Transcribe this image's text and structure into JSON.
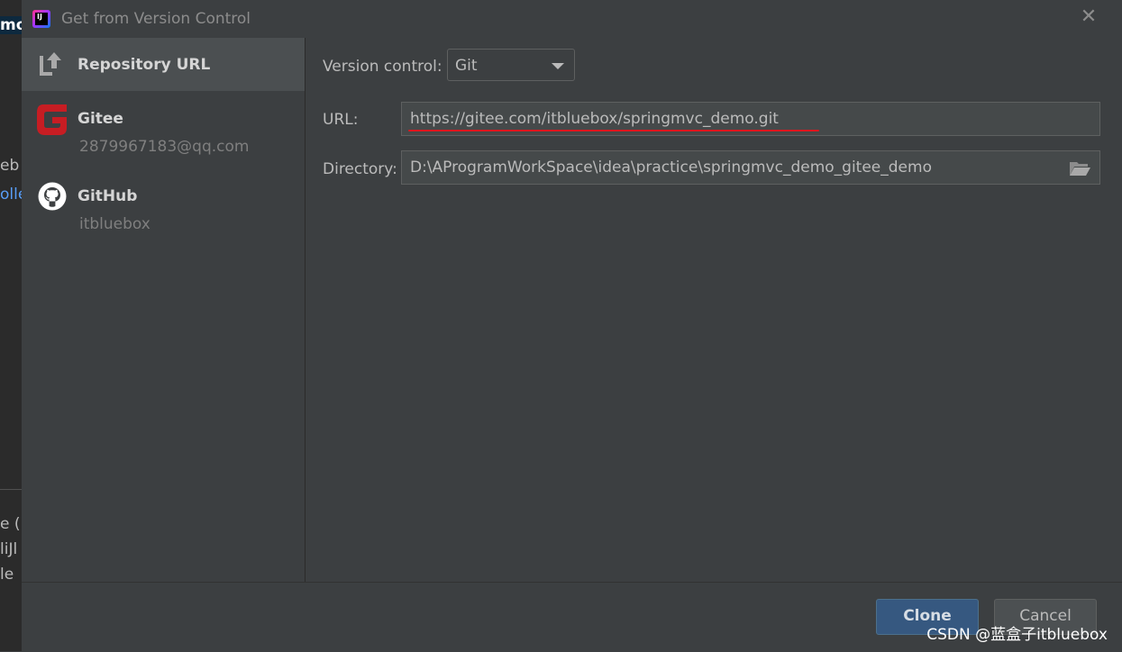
{
  "dialog": {
    "title": "Get from Version Control",
    "close_glyph": "✕"
  },
  "background_ide": {
    "fragments": [
      "mo",
      "eb",
      "olle",
      "e (",
      "liJl",
      "le"
    ]
  },
  "sidebar": {
    "items": [
      {
        "label": "Repository URL",
        "sub": "",
        "icon": "repository-url-icon",
        "selected": true
      },
      {
        "label": "Gitee",
        "sub": "2879967183@qq.com",
        "icon": "gitee-logo-icon",
        "selected": false
      },
      {
        "label": "GitHub",
        "sub": "itbluebox",
        "icon": "github-logo-icon",
        "selected": false
      }
    ]
  },
  "form": {
    "version_control_label": "Version control:",
    "version_control_value": "Git",
    "url_label": "URL:",
    "url_value": "https://gitee.com/itbluebox/springmvc_demo.git",
    "directory_label": "Directory:",
    "directory_value": "D:\\AProgramWorkSpace\\idea\\practice\\springmvc_demo_gitee_demo"
  },
  "buttons": {
    "clone": "Clone",
    "cancel": "Cancel"
  },
  "watermark": "CSDN @蓝盒子itbluebox",
  "colors": {
    "background": "#3c3f41",
    "selected_item": "#4b4f51",
    "primary_button": "#365880",
    "gitee_red": "#c71d23",
    "url_underline": "#e0151d"
  }
}
